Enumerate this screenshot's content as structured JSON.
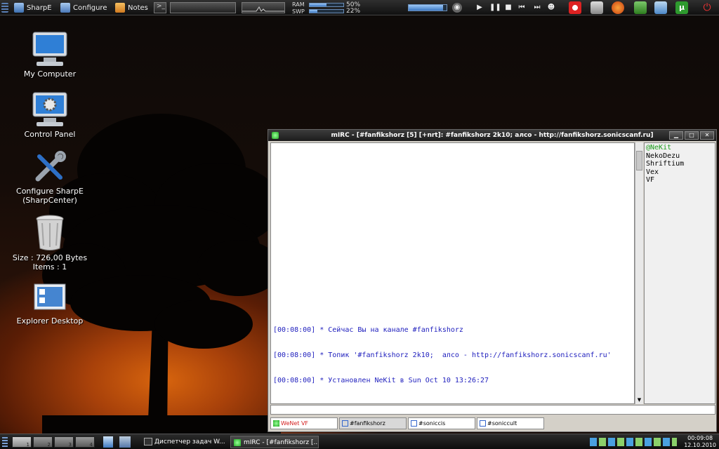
{
  "topbar": {
    "sharpe_label": "SharpE",
    "configure_label": "Configure",
    "notes_label": "Notes",
    "ram_label": "RAM",
    "swp_label": "SWP",
    "ram_pct": "50%",
    "swp_pct": "22%",
    "ram_value": 0.5,
    "swp_value": 0.22,
    "volume_value": 0.9
  },
  "desktop": {
    "icons": [
      {
        "label": "My Computer"
      },
      {
        "label": "Control Panel"
      },
      {
        "label": "Configure SharpE",
        "label2": "(SharpCenter)"
      },
      {
        "label": "Size : 726,00 Bytes",
        "label2": "Items : 1"
      },
      {
        "label": "Explorer Desktop"
      }
    ]
  },
  "mirc": {
    "title": "mIRC - [#fanfikshorz [5] [+nrt]: #fanfikshorz 2k10;  алсо - http://fanfikshorz.sonicscanf.ru]",
    "chat_lines": [
      "[00:08:00] * Сейчас Вы на канале #fanfikshorz",
      "[00:08:00] * Топик '#fanfikshorz 2k10;  алсо - http://fanfikshorz.sonicscanf.ru'",
      "[00:08:00] * Установлен NeKit в Sun Oct 10 13:26:27"
    ],
    "nicks": [
      "@NeKit",
      "NekoDezu",
      "Shriftium",
      "Vex",
      "VF"
    ],
    "tabs": [
      "WeNet VF",
      "#fanfikshorz",
      "#soniccis",
      "#soniccult"
    ]
  },
  "taskbar": {
    "vdesks": [
      "1",
      "2",
      "3",
      "4"
    ],
    "tasks": [
      "Диспетчер задач W...",
      "mIRC - [#fanfikshorz [..."
    ],
    "time": "00:09:08",
    "date": "12.10.2010"
  },
  "colors": {
    "chat_text": "#1d1dbd",
    "op_nick": "#1a9a1a",
    "network_tab": "#d42020"
  }
}
